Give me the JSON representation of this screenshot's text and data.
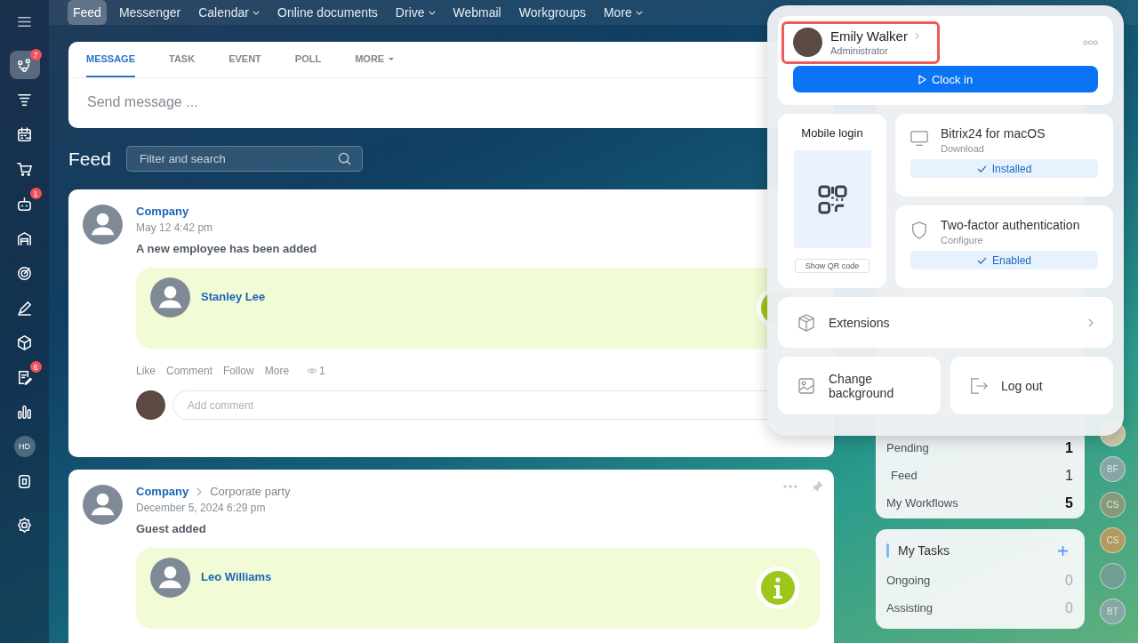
{
  "sidebar": {
    "items": [
      {
        "selected": false
      },
      {
        "selected": true,
        "badge": "7"
      },
      {
        "selected": false
      },
      {
        "selected": false
      },
      {
        "selected": false
      },
      {
        "selected": false,
        "badge": "1"
      },
      {
        "selected": false
      },
      {
        "selected": false
      },
      {
        "selected": false
      },
      {
        "selected": false
      },
      {
        "selected": false,
        "badge": "6"
      },
      {
        "selected": false
      },
      {
        "selected": false,
        "text": "HD"
      },
      {
        "selected": false
      },
      {
        "selected": false
      }
    ]
  },
  "top_nav": [
    {
      "label": "Feed",
      "selected": true,
      "dropdown": false
    },
    {
      "label": "Messenger",
      "selected": false,
      "dropdown": false
    },
    {
      "label": "Calendar",
      "selected": false,
      "dropdown": true
    },
    {
      "label": "Online documents",
      "selected": false,
      "dropdown": false
    },
    {
      "label": "Drive",
      "selected": false,
      "dropdown": true
    },
    {
      "label": "Webmail",
      "selected": false,
      "dropdown": false
    },
    {
      "label": "Workgroups",
      "selected": false,
      "dropdown": false
    },
    {
      "label": "More",
      "selected": false,
      "dropdown": true
    }
  ],
  "composer": {
    "tabs": [
      {
        "label": "MESSAGE",
        "selected": true,
        "dropdown": false
      },
      {
        "label": "TASK",
        "selected": false,
        "dropdown": false
      },
      {
        "label": "EVENT",
        "selected": false,
        "dropdown": false
      },
      {
        "label": "POLL",
        "selected": false,
        "dropdown": false
      },
      {
        "label": "MORE",
        "selected": false,
        "dropdown": true
      }
    ],
    "placeholder": "Send message ..."
  },
  "feed": {
    "title": "Feed",
    "search": {
      "placeholder": "Filter and search"
    },
    "posts": [
      {
        "author": "Company",
        "date": "May 12 4:42 pm",
        "title": "A new employee has been added",
        "person": "Stanley Lee",
        "actions": [
          "Like",
          "Comment",
          "Follow",
          "More"
        ],
        "views": "1",
        "comment": {
          "placeholder": "Add comment"
        }
      },
      {
        "author": "Company",
        "target": "Corporate party",
        "date": "December 5, 2024 6:29 pm",
        "title": "Guest added",
        "person": "Leo Williams"
      }
    ]
  },
  "right_panel": {
    "counters": [
      {
        "label": "Pending",
        "value": "1",
        "bold": true,
        "indent": false
      },
      {
        "label": "Feed",
        "value": "1",
        "bold": false,
        "indent": true
      },
      {
        "label": "My Workflows",
        "value": "5",
        "bold": true,
        "indent": false
      }
    ],
    "tasks": {
      "title": "My Tasks",
      "rows": [
        {
          "label": "Ongoing",
          "value": "0"
        },
        {
          "label": "Assisting",
          "value": "0"
        }
      ]
    }
  },
  "online_users": [
    {
      "kind": "photo",
      "color": "#c9c7a8"
    },
    {
      "kind": "initials",
      "text": "BF",
      "color": "#86a7a4"
    },
    {
      "kind": "initials",
      "text": "CS",
      "color": "#86997a"
    },
    {
      "kind": "initials",
      "text": "CS",
      "color": "#b39a5e"
    },
    {
      "kind": "photo",
      "color": "#6f9f94"
    },
    {
      "kind": "initials",
      "text": "BT",
      "color": "#86a7a4"
    }
  ],
  "profile_popup": {
    "user": {
      "name": "Emily Walker",
      "role": "Administrator",
      "highlighted": true
    },
    "clock_in": "Clock in",
    "mobile_login": {
      "title": "Mobile login",
      "button": "Show QR code"
    },
    "apps": [
      {
        "title": "Bitrix24 for macOS",
        "subtitle": "Download",
        "status": "Installed"
      },
      {
        "title": "Two-factor authentication",
        "subtitle": "Configure",
        "status": "Enabled"
      }
    ],
    "extensions": "Extensions",
    "change_background": "Change background",
    "log_out": "Log out"
  }
}
